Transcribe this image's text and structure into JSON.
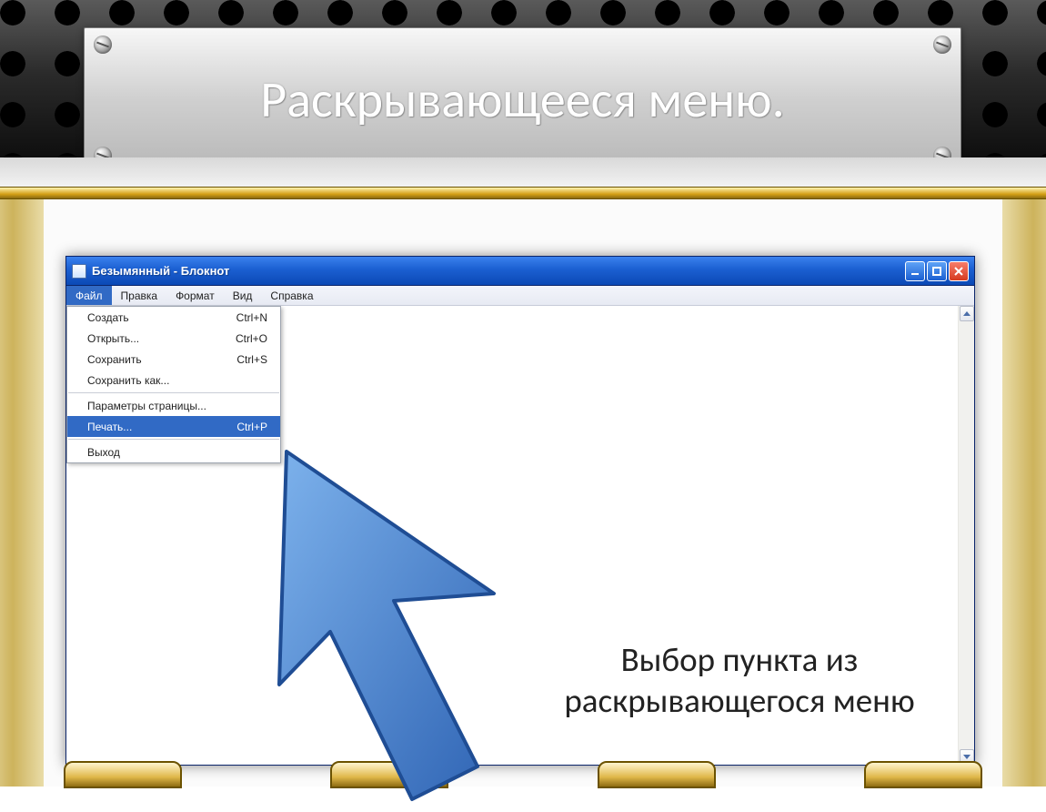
{
  "slide": {
    "title": "Раскрывающееся меню."
  },
  "window": {
    "title": "Безымянный - Блокнот",
    "menubar": [
      "Файл",
      "Правка",
      "Формат",
      "Вид",
      "Справка"
    ],
    "active_menu_index": 0
  },
  "dropdown": {
    "groups": [
      [
        {
          "label": "Создать",
          "shortcut": "Ctrl+N",
          "selected": false
        },
        {
          "label": "Открыть...",
          "shortcut": "Ctrl+O",
          "selected": false
        },
        {
          "label": "Сохранить",
          "shortcut": "Ctrl+S",
          "selected": false
        },
        {
          "label": "Сохранить как...",
          "shortcut": "",
          "selected": false
        }
      ],
      [
        {
          "label": "Параметры страницы...",
          "shortcut": "",
          "selected": false
        },
        {
          "label": "Печать...",
          "shortcut": "Ctrl+P",
          "selected": true
        }
      ],
      [
        {
          "label": "Выход",
          "shortcut": "",
          "selected": false
        }
      ]
    ]
  },
  "caption": "Выбор пункта из раскрывающегося меню",
  "colors": {
    "xp_blue": "#1b5fd1",
    "highlight": "#316ac5",
    "gold": "#d4a017"
  }
}
